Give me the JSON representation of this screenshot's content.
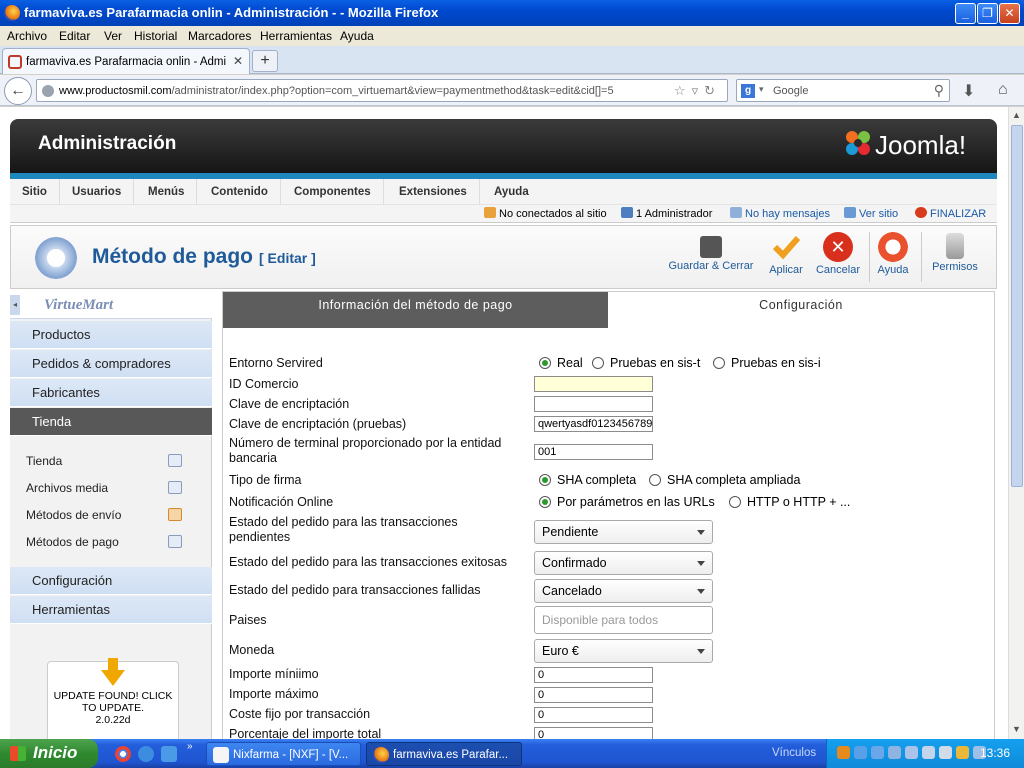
{
  "window": {
    "title": "farmaviva.es Parafarmacia onlin - Administración - - Mozilla Firefox",
    "min": "_",
    "max": "❐",
    "close": "✕"
  },
  "menubar": [
    "Archivo",
    "Editar",
    "Ver",
    "Historial",
    "Marcadores",
    "Herramientas",
    "Ayuda"
  ],
  "tab": {
    "label": "farmaviva.es Parafarmacia onlin - Administra...",
    "close": "✕",
    "new": "+"
  },
  "nav": {
    "url_domain": "www.productosmil.com",
    "url_path": "/administrator/index.php?option=com_virtuemart&view=paymentmethod&task=edit&cid[]=5",
    "search_placeholder": "Google"
  },
  "joomla": {
    "header_title": "Administración",
    "logo_text": "Joomla!",
    "menu": [
      "Sitio",
      "Usuarios",
      "Menús",
      "Contenido",
      "Componentes",
      "Extensiones",
      "Ayuda"
    ],
    "status": {
      "offline": "No conectados al sitio",
      "admins": "1 Administrador",
      "messages": "No hay mensajes",
      "view_site": "Ver sitio",
      "logout": "FINALIZAR"
    }
  },
  "toolbar": {
    "page_title": "Método de pago",
    "edit_label": "[ Editar ]",
    "buttons": {
      "save_close": "Guardar & Cerrar",
      "apply": "Aplicar",
      "cancel": "Cancelar",
      "help": "Ayuda",
      "permissions": "Permisos"
    }
  },
  "sidebar": {
    "brand": "VirtueMart",
    "items": [
      "Productos",
      "Pedidos & compradores",
      "Fabricantes",
      "Tienda"
    ],
    "subitems": [
      "Tienda",
      "Archivos media",
      "Métodos de envío",
      "Métodos de pago"
    ],
    "bottom_items": [
      "Configuración",
      "Herramientas"
    ],
    "update": {
      "line1": "UPDATE FOUND! CLICK",
      "line2": "TO UPDATE.",
      "version": "2.0.22d"
    }
  },
  "form": {
    "tabs": [
      "Información del método de pago",
      "Configuración"
    ],
    "entorno": {
      "label": "Entorno Servired",
      "options": [
        "Real",
        "Pruebas en sis-t",
        "Pruebas en sis-i"
      ],
      "selected": 0
    },
    "id_comercio": {
      "label": "ID Comercio",
      "value": ""
    },
    "clave": {
      "label": "Clave de encriptación",
      "value": ""
    },
    "clave_pruebas": {
      "label": "Clave de encriptación (pruebas)",
      "value": "qwertyasdf0123456789"
    },
    "terminal": {
      "label": "Número de terminal proporcionado por la entidad bancaria",
      "value": "001"
    },
    "firma": {
      "label": "Tipo de firma",
      "options": [
        "SHA completa",
        "SHA completa ampliada"
      ],
      "selected": 0
    },
    "notificacion": {
      "label": "Notificación Online",
      "options": [
        "Por parámetros en las URLs",
        "HTTP o HTTP + ..."
      ],
      "selected": 0
    },
    "estado_pendiente": {
      "label": "Estado del pedido para las transacciones pendientes",
      "value": "Pendiente"
    },
    "estado_exitosas": {
      "label": "Estado del pedido para las transacciones exitosas",
      "value": "Confirmado"
    },
    "estado_fallidas": {
      "label": "Estado del pedido para transacciones fallidas",
      "value": "Cancelado"
    },
    "paises": {
      "label": "Paises",
      "placeholder": "Disponible para todos"
    },
    "moneda": {
      "label": "Moneda",
      "value": "Euro €"
    },
    "importe_min": {
      "label": "Importe míniimo",
      "value": "0"
    },
    "importe_max": {
      "label": "Importe máximo",
      "value": "0"
    },
    "coste_fijo": {
      "label": "Coste fijo por transacción",
      "value": "0"
    },
    "porcentaje": {
      "label": "Porcentaje del importe total",
      "value": "0"
    }
  },
  "taskbar": {
    "start": "Inicio",
    "items": [
      "Nixfarma - [NXF] - [V...",
      "farmaviva.es Parafar..."
    ],
    "links": "Vínculos",
    "clock": "13:36"
  }
}
